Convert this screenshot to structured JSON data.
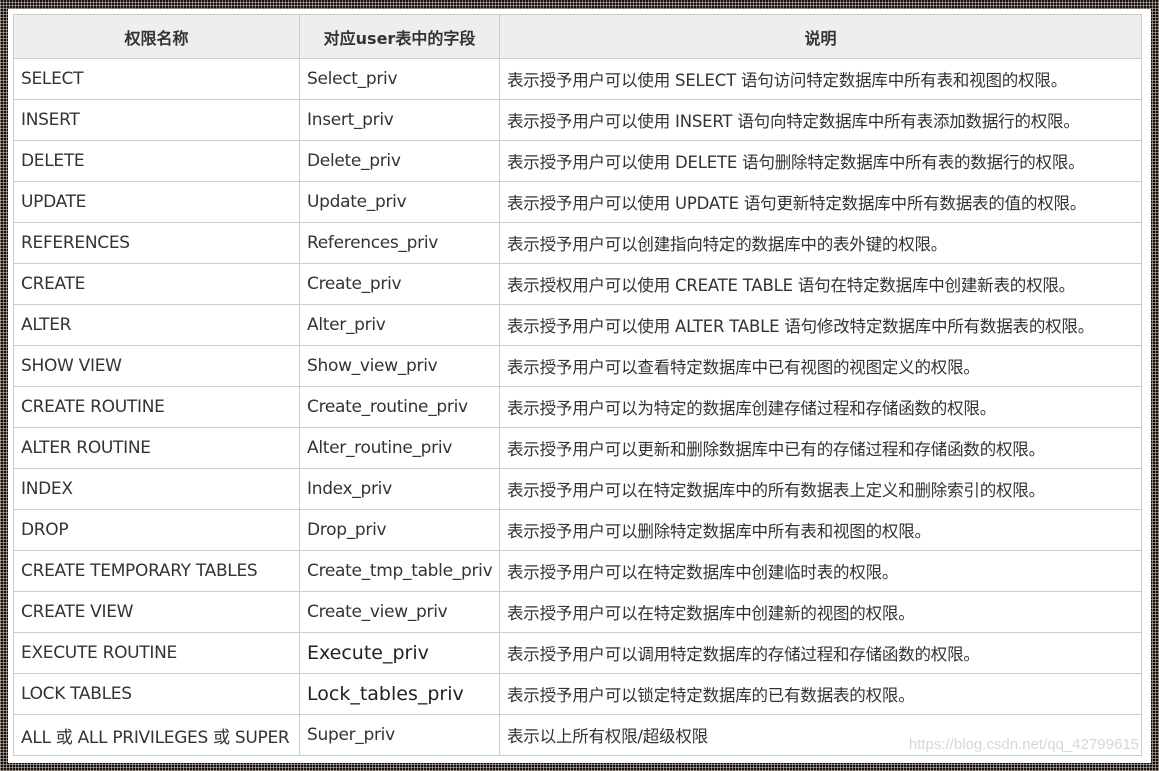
{
  "table": {
    "headers": [
      "权限名称",
      "对应user表中的字段",
      "说明"
    ],
    "rows": [
      {
        "name": "SELECT",
        "field": "Select_priv",
        "desc": "表示授予用户可以使用 SELECT 语句访问特定数据库中所有表和视图的权限。"
      },
      {
        "name": "INSERT",
        "field": "Insert_priv",
        "desc": "表示授予用户可以使用 INSERT 语句向特定数据库中所有表添加数据行的权限。"
      },
      {
        "name": "DELETE",
        "field": "Delete_priv",
        "desc": "表示授予用户可以使用 DELETE 语句删除特定数据库中所有表的数据行的权限。"
      },
      {
        "name": "UPDATE",
        "field": "Update_priv",
        "desc": "表示授予用户可以使用 UPDATE 语句更新特定数据库中所有数据表的值的权限。"
      },
      {
        "name": "REFERENCES",
        "field": "References_priv",
        "desc": "表示授予用户可以创建指向特定的数据库中的表外键的权限。"
      },
      {
        "name": "CREATE",
        "field": "Create_priv",
        "desc": "表示授权用户可以使用 CREATE TABLE 语句在特定数据库中创建新表的权限。"
      },
      {
        "name": "ALTER",
        "field": "Alter_priv",
        "desc": "表示授予用户可以使用 ALTER TABLE 语句修改特定数据库中所有数据表的权限。"
      },
      {
        "name": "SHOW VIEW",
        "field": "Show_view_priv",
        "desc": "表示授予用户可以查看特定数据库中已有视图的视图定义的权限。"
      },
      {
        "name": "CREATE ROUTINE",
        "field": "Create_routine_priv",
        "desc": "表示授予用户可以为特定的数据库创建存储过程和存储函数的权限。"
      },
      {
        "name": "ALTER ROUTINE",
        "field": "Alter_routine_priv",
        "desc": "表示授予用户可以更新和删除数据库中已有的存储过程和存储函数的权限。"
      },
      {
        "name": "INDEX",
        "field": "Index_priv",
        "desc": "表示授予用户可以在特定数据库中的所有数据表上定义和删除索引的权限。"
      },
      {
        "name": "DROP",
        "field": "Drop_priv",
        "desc": "表示授予用户可以删除特定数据库中所有表和视图的权限。"
      },
      {
        "name": "CREATE TEMPORARY TABLES",
        "field": "Create_tmp_table_priv",
        "desc": "表示授予用户可以在特定数据库中创建临时表的权限。"
      },
      {
        "name": "CREATE VIEW",
        "field": "Create_view_priv",
        "desc": "表示授予用户可以在特定数据库中创建新的视图的权限。"
      },
      {
        "name": "EXECUTE ROUTINE",
        "field": "Execute_priv",
        "desc": "表示授予用户可以调用特定数据库的存储过程和存储函数的权限。"
      },
      {
        "name": "LOCK TABLES",
        "field": "Lock_tables_priv",
        "desc": "表示授予用户可以锁定特定数据库的已有数据表的权限。"
      },
      {
        "name": "ALL 或 ALL PRIVILEGES 或 SUPER",
        "field": "Super_priv",
        "desc": "表示以上所有权限/超级权限"
      }
    ]
  },
  "watermark": "https://blog.csdn.net/qq_42799615"
}
